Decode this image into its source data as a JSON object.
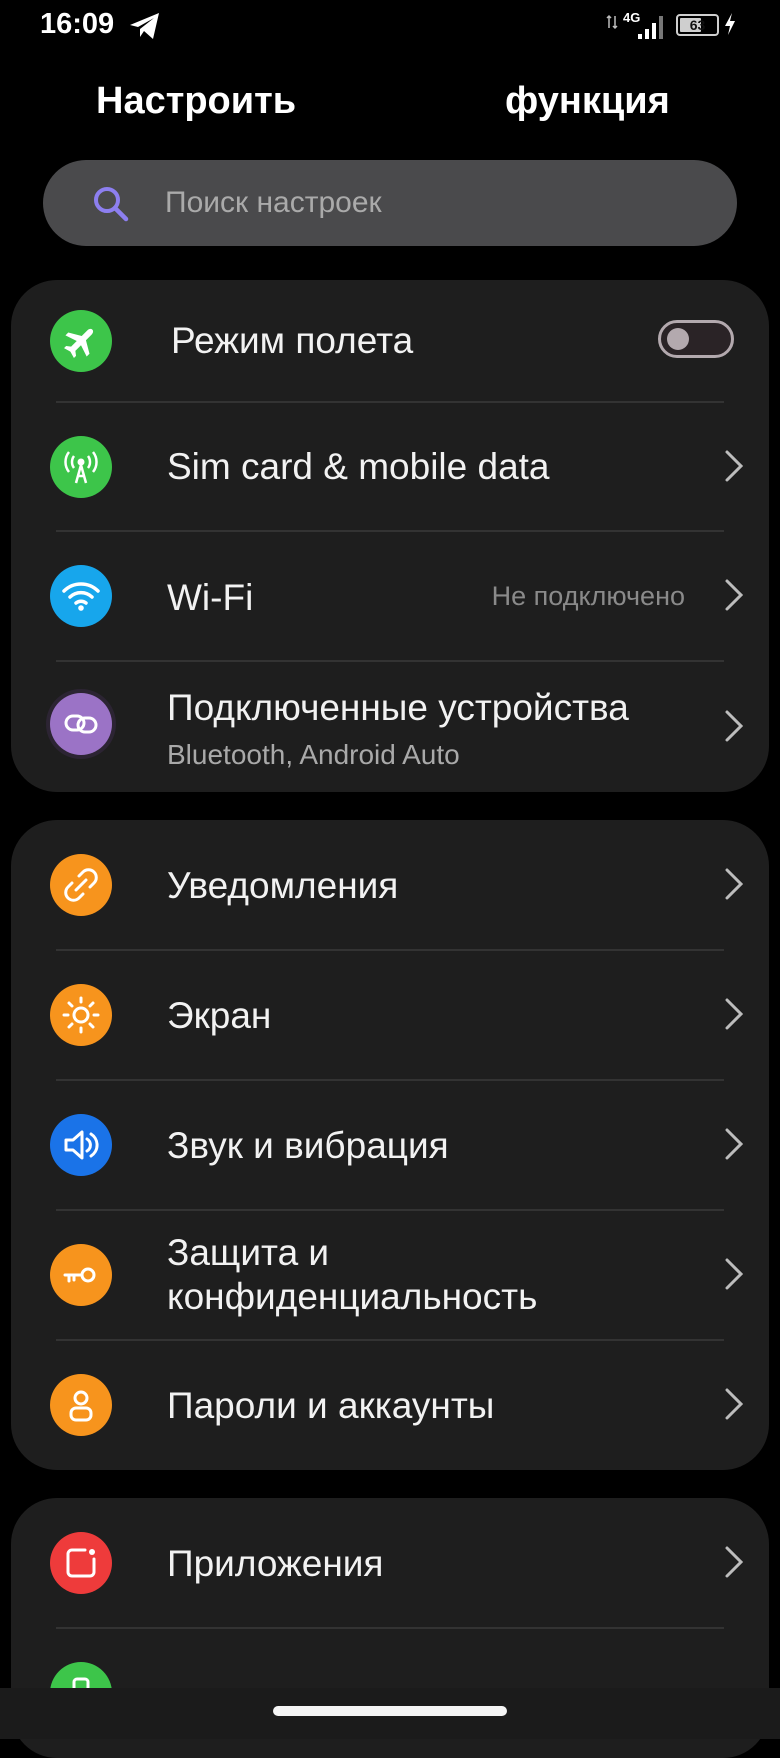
{
  "status_bar": {
    "time": "16:09",
    "network": "4G",
    "battery_percent": "63",
    "battery_level": 0.63,
    "icons": [
      "telegram-icon",
      "data-arrows-icon",
      "signal-icon",
      "battery-icon",
      "charging-icon"
    ]
  },
  "header": {
    "left_title": "Настроить",
    "right_title": "функция"
  },
  "search": {
    "placeholder": "Поиск настроек",
    "value": ""
  },
  "sections": {
    "connectivity": [
      {
        "label": "Режим полета",
        "icon": "airplane-icon",
        "icon_color": "#3dc54a",
        "control": "toggle",
        "toggle_on": false
      },
      {
        "label": "Sim card & mobile data",
        "icon": "antenna-icon",
        "icon_color": "#3dc54a"
      },
      {
        "label": "Wi-Fi",
        "icon": "wifi-icon",
        "icon_color": "#17a6ec",
        "status": "Не подключено"
      },
      {
        "label": "Подключенные устройства",
        "icon": "link-icon",
        "icon_color": "#9b73c6",
        "subtitle": "Bluetooth, Android Auto"
      }
    ],
    "system": [
      {
        "label": "Уведомления",
        "icon": "bell-link-icon",
        "icon_color": "#f7941d"
      },
      {
        "label": "Экран",
        "icon": "sun-icon",
        "icon_color": "#f7941d"
      },
      {
        "label": "Звук и вибрация",
        "icon": "speaker-icon",
        "icon_color": "#1a73e8"
      },
      {
        "label_line1": "Защита и",
        "label_line2": "конфиденциальность",
        "icon": "key-icon",
        "icon_color": "#f7941d"
      },
      {
        "label": "Пароли и аккаунты",
        "icon": "user-icon",
        "icon_color": "#f7941d"
      }
    ],
    "apps": [
      {
        "label": "Приложения",
        "icon": "apps-icon",
        "icon_color": "#ee3b3b"
      }
    ]
  },
  "colors": {
    "background": "#000000",
    "card": "#1e1e1e",
    "search_bg": "#4a4a4c",
    "search_icon": "#8d7ff0",
    "green_partial": "#3dc54a"
  }
}
